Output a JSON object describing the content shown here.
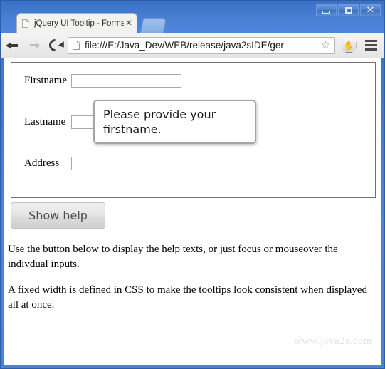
{
  "window": {
    "controls": [
      {
        "name": "minimize",
        "glyph": "–"
      },
      {
        "name": "maximize",
        "glyph": "□"
      },
      {
        "name": "close",
        "glyph": "✕"
      }
    ]
  },
  "browser": {
    "tab": {
      "title": "jQuery UI Tooltip - Forms",
      "close_glyph": "✕",
      "favicon": "page-icon"
    },
    "new_tab_label": "",
    "toolbar": {
      "back_label": "Back",
      "forward_label": "Forward",
      "reload_label": "Reload",
      "url": "file:///E:/Java_Dev/WEB/release/java2sIDE/ger",
      "star_glyph": "☆",
      "extension_glyph": "✋",
      "menu_label": "Customize and control"
    }
  },
  "page": {
    "form": {
      "fields": [
        {
          "label": "Firstname",
          "value": "",
          "placeholder": ""
        },
        {
          "label": "Lastname",
          "value": "",
          "placeholder": ""
        },
        {
          "label": "Address",
          "value": "",
          "placeholder": ""
        }
      ]
    },
    "tooltip": {
      "text": "Please provide your firstname.",
      "target_field": "Firstname"
    },
    "show_help_button": "Show help",
    "paragraphs": [
      "Use the button below to display the help texts, or just focus or mouseover the indivdual inputs.",
      "A fixed width is defined in CSS to make the tooltips look consistent when displayed all at once."
    ],
    "watermark": "www.java2s.com"
  },
  "colors": {
    "title_bar": "#4a82d6",
    "tab_active": "#f2f2f0",
    "toolbar": "#e9e9e9",
    "form_border": "#707070",
    "tooltip_border": "#a5a5a5",
    "watermark": "#e2e2e2"
  }
}
